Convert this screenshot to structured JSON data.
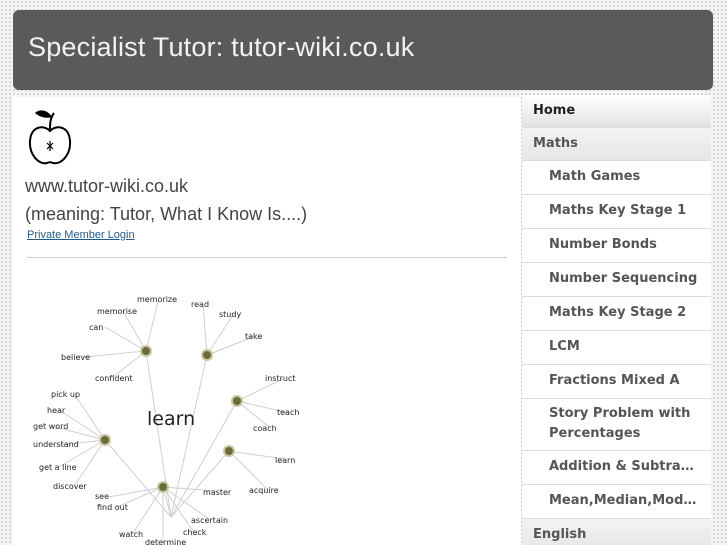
{
  "header": {
    "title": "Specialist Tutor: tutor-wiki.co.uk"
  },
  "main": {
    "site_url": "www.tutor-wiki.co.uk",
    "meaning": "(meaning: Tutor, What I Know Is....)",
    "login_link": "Private Member Login",
    "mindmap": {
      "center": "learn",
      "words": [
        "memorize",
        "read",
        "study",
        "memorise",
        "can",
        "take",
        "believe",
        "confident",
        "instruct",
        "pick up",
        "hear",
        "get word",
        "understand",
        "teach",
        "coach",
        "get a line",
        "learn",
        "discover",
        "see",
        "find out",
        "master",
        "acquire",
        "watch",
        "ascertain",
        "check",
        "determine"
      ]
    }
  },
  "sidebar": {
    "items": [
      {
        "label": "Home",
        "level": 1
      },
      {
        "label": "Maths",
        "level": 1
      },
      {
        "label": "Math Games",
        "level": 2
      },
      {
        "label": "Maths Key Stage 1",
        "level": 2
      },
      {
        "label": "Number Bonds",
        "level": 2
      },
      {
        "label": "Number Sequencing",
        "level": 2
      },
      {
        "label": "Maths Key Stage 2",
        "level": 2
      },
      {
        "label": "LCM",
        "level": 2
      },
      {
        "label": "Fractions Mixed A",
        "level": 2
      },
      {
        "label": "Story Problem with Percentages",
        "level": 2
      },
      {
        "label": "Addition & Subtraction",
        "level": 2
      },
      {
        "label": "Mean,Median,Mode,Range",
        "level": 2
      },
      {
        "label": "English",
        "level": 1
      }
    ]
  },
  "colors": {
    "header_bg": "#5a5a5a",
    "header_text": "#f2f2f2",
    "link": "#1f5a8a",
    "node": "#6b6b3a"
  }
}
